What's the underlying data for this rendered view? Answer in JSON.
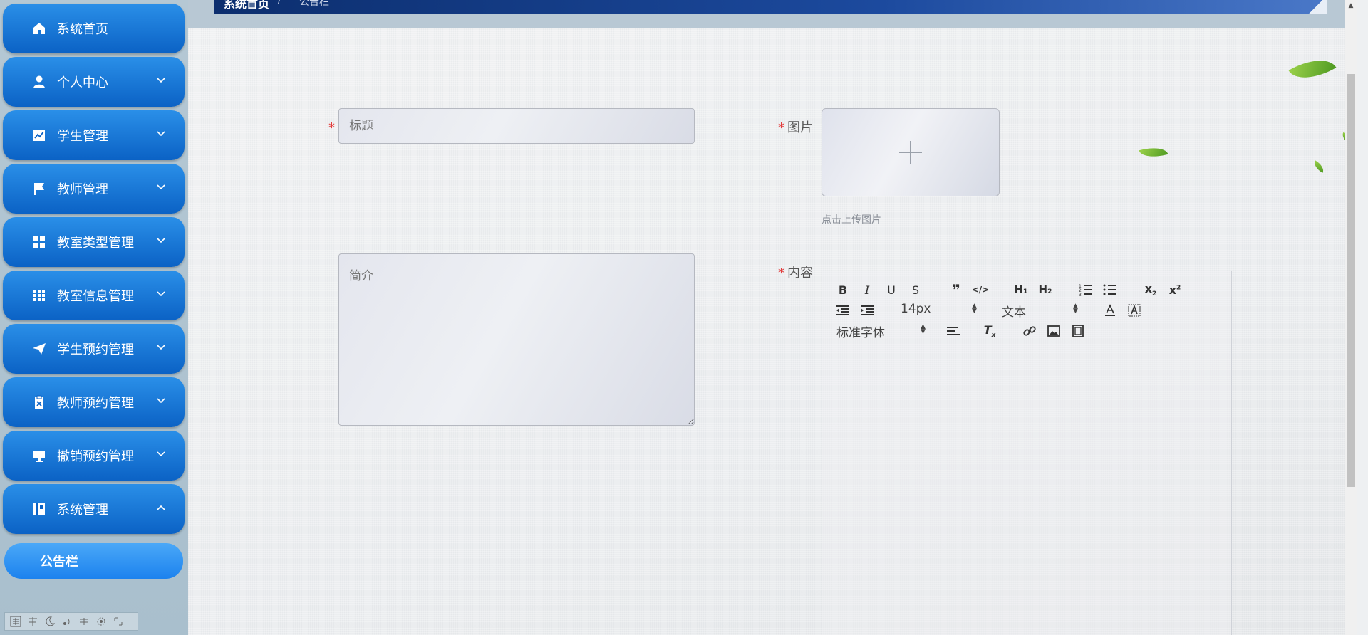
{
  "header": {
    "title": "系统首页",
    "separator": "/",
    "page": "公告栏"
  },
  "sidebar": {
    "items": [
      {
        "label": "系统首页",
        "icon": "home-icon",
        "expandable": false
      },
      {
        "label": "个人中心",
        "icon": "user-icon",
        "expandable": true
      },
      {
        "label": "学生管理",
        "icon": "chart-icon",
        "expandable": true
      },
      {
        "label": "教师管理",
        "icon": "flag-icon",
        "expandable": true
      },
      {
        "label": "教室类型管理",
        "icon": "grid-icon",
        "expandable": true
      },
      {
        "label": "教室信息管理",
        "icon": "apps-icon",
        "expandable": true
      },
      {
        "label": "学生预约管理",
        "icon": "send-icon",
        "expandable": true
      },
      {
        "label": "教师预约管理",
        "icon": "clipboard-x-icon",
        "expandable": true
      },
      {
        "label": "撤销预约管理",
        "icon": "monitor-icon",
        "expandable": true
      },
      {
        "label": "系统管理",
        "icon": "book-icon",
        "expandable": true,
        "expanded": true
      }
    ],
    "sub_items": [
      {
        "label": "公告栏"
      }
    ]
  },
  "form": {
    "title": {
      "label": "标题",
      "required": true,
      "placeholder": "标题",
      "value": ""
    },
    "image": {
      "label": "图片",
      "required": true,
      "hint": "点击上传图片"
    },
    "intro": {
      "label": "简介",
      "required": false,
      "placeholder": "简介",
      "value": ""
    },
    "content": {
      "label": "内容",
      "required": true,
      "required_mark": "*"
    }
  },
  "editor": {
    "font_size": "14px",
    "header_select": "文本",
    "font_family": "标准字体",
    "buttons": [
      "bold",
      "italic",
      "underline",
      "strike",
      "blockquote",
      "code-block",
      "h1",
      "h2",
      "ordered-list",
      "bullet-list",
      "subscript",
      "superscript",
      "outdent",
      "indent",
      "color",
      "background",
      "align",
      "clean",
      "link",
      "image",
      "video"
    ]
  },
  "colors": {
    "accent": "#0b62c5",
    "required": "#e23c3c",
    "header": "#1c4a9e"
  }
}
